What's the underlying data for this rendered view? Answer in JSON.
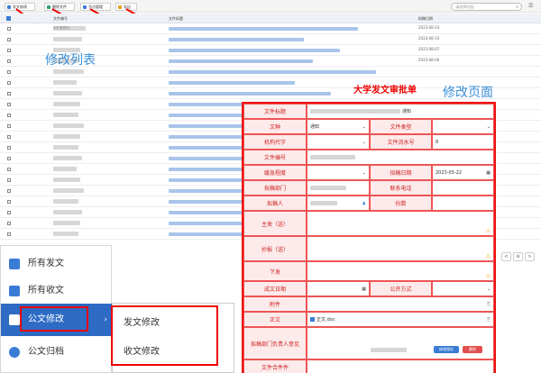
{
  "toolbar": {
    "buttons": [
      {
        "label": "发文修改",
        "color": "#3a7bd5"
      },
      {
        "label": "删除文件",
        "color": "#2f9e6b"
      },
      {
        "label": "节点管理",
        "color": "#3a7bd5"
      },
      {
        "label": "导出",
        "color": "#e0a21c"
      }
    ],
    "search_placeholder": "-请选择内容-"
  },
  "table": {
    "headers": [
      "文件编号",
      "文件标题",
      "拟稿日期"
    ],
    "rows": [
      {
        "num": "中扩发资字( ",
        "date": "2023-08-14"
      },
      {
        "num": "",
        "date": "2023-08-10"
      },
      {
        "num": "",
        "date": "2023-08-07"
      },
      {
        "num": "",
        "date": "2023-08-06"
      },
      {
        "num": "",
        "date": ""
      },
      {
        "num": "",
        "date": ""
      },
      {
        "num": "",
        "date": ""
      },
      {
        "num": "",
        "date": ""
      },
      {
        "num": "",
        "date": ""
      },
      {
        "num": "",
        "date": ""
      },
      {
        "num": "",
        "date": ""
      },
      {
        "num": "",
        "date": ""
      },
      {
        "num": "",
        "date": ""
      },
      {
        "num": "",
        "date": ""
      },
      {
        "num": "",
        "date": ""
      },
      {
        "num": "",
        "date": ""
      },
      {
        "num": "",
        "date": ""
      },
      {
        "num": "",
        "date": ""
      },
      {
        "num": "",
        "date": ""
      },
      {
        "num": "",
        "date": ""
      }
    ]
  },
  "annotations": {
    "list": "修改列表",
    "page": "修改页面"
  },
  "sidebar": {
    "items": [
      {
        "label": "所有发文",
        "icon": "send-icon"
      },
      {
        "label": "所有收文",
        "icon": "inbox-icon"
      },
      {
        "label": "公文修改",
        "icon": "edit-icon"
      },
      {
        "label": "公文归档",
        "icon": "archive-icon"
      }
    ],
    "submenu": [
      "发文修改",
      "收文修改"
    ]
  },
  "form": {
    "title": "大学发文审批单",
    "fields": {
      "doc_title": {
        "label": "文件标题",
        "suffix": "通知"
      },
      "doc_type": {
        "label": "文种",
        "value": "通知"
      },
      "category": {
        "label": "文件类型",
        "value": ""
      },
      "org_code": {
        "label": "机构代字",
        "value": ""
      },
      "serial": {
        "label": "文件流水号",
        "value": "8"
      },
      "doc_no": {
        "label": "文件编号",
        "value": ""
      },
      "urgency": {
        "label": "缓急程度",
        "value": ""
      },
      "draft_date": {
        "label": "拟稿日期",
        "value": "2023-05-22"
      },
      "dept": {
        "label": "拟稿部门",
        "value": ""
      },
      "phone": {
        "label": "联系电话",
        "value": ""
      },
      "drafter": {
        "label": "拟稿人",
        "value": ""
      },
      "copies": {
        "label": "份数",
        "value": ""
      },
      "main_send": {
        "label": "主发（送）"
      },
      "cc_send": {
        "label": "抄报（送）"
      },
      "issue": {
        "label": "下发"
      },
      "done_date": {
        "label": "成文日期"
      },
      "public": {
        "label": "公开方式"
      },
      "attach": {
        "label": "附件"
      },
      "body": {
        "label": "正文",
        "file": "正文.doc"
      },
      "opinion": {
        "label": "拟稿部门负责人意见"
      },
      "cover": {
        "label": "文件合件件"
      }
    },
    "buttons": {
      "save": "修改保存",
      "delete": "删除"
    }
  }
}
